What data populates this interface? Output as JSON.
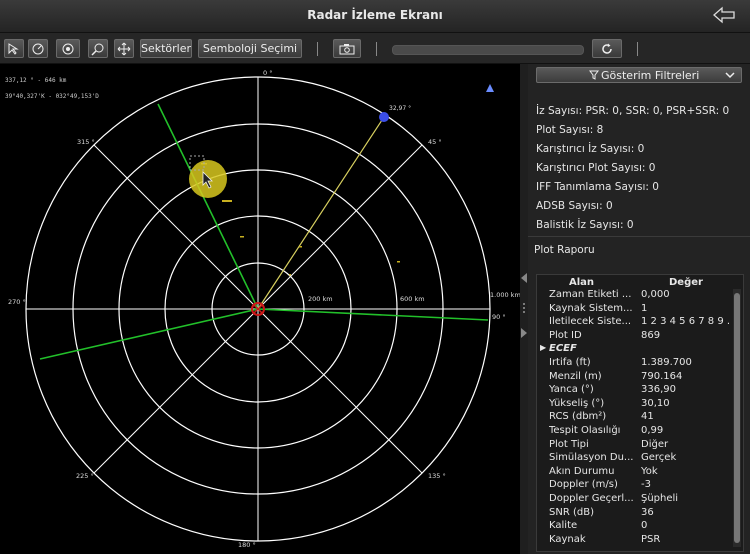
{
  "window": {
    "title": "Radar İzleme Ekranı"
  },
  "toolbar": {
    "icons": [
      "select-icon",
      "gauge-icon",
      "target-icon",
      "zoom-icon",
      "pan-icon"
    ],
    "sectors_label": "Sektörler",
    "symbology_label": "Semboloji Seçimi",
    "camera_icon": "camera-icon",
    "refresh_icon": "refresh-icon",
    "progress": 0
  },
  "radar": {
    "cursor_readout": "337,12 ° - 646 km",
    "cursor_latlon": "39°40,327'K - 032°49,153'D",
    "range_labels": [
      "200 km",
      "600 km",
      "1.000 km"
    ],
    "bearing_labels": {
      "b0": "0 °",
      "b45": "45 °",
      "b90": "90 °",
      "b135": "135 °",
      "b180": "180 °",
      "b225": "225 °",
      "b270": "270 °",
      "b315": "315 °"
    },
    "target_label": "32,97 °",
    "colors": {
      "rings": "#ffffff",
      "green_line": "#22c02a",
      "yellow_line": "#d8d060",
      "target": "#3b4ee8",
      "highlight": "#d8c81e",
      "center": "#d01818"
    }
  },
  "filters": {
    "label": "Gösterim Filtreleri"
  },
  "stats": [
    "İz Sayısı: PSR: 0, SSR: 0, PSR+SSR: 0",
    "Plot Sayısı: 8",
    "Karıştırıcı İz Sayısı: 0",
    "Karıştırıcı Plot Sayısı: 0",
    "IFF Tanımlama Sayısı: 0",
    "ADSB Sayısı: 0",
    "Balistik İz Sayısı: 0"
  ],
  "plot_report": {
    "title": "Plot Raporu",
    "headers": {
      "field": "Alan",
      "value": "Değer"
    },
    "rows": [
      {
        "field": "Zaman Etiketi ...",
        "value": "0,000"
      },
      {
        "field": "Kaynak Sistem...",
        "value": "1"
      },
      {
        "field": "İletilecek Siste...",
        "value": "1 2 3 4 5 6 7 8 9 ..."
      },
      {
        "field": "Plot ID",
        "value": "869"
      },
      {
        "field": "ECEF",
        "value": "",
        "group": true
      },
      {
        "field": "İrtifa (ft)",
        "value": "1.389.700"
      },
      {
        "field": "Menzil (m)",
        "value": "790.164"
      },
      {
        "field": "Yanca (°)",
        "value": "336,90"
      },
      {
        "field": "Yükseliş (°)",
        "value": "30,10"
      },
      {
        "field": "RCS (dbm²)",
        "value": "41"
      },
      {
        "field": "Tespit Olasılığı",
        "value": "0,99"
      },
      {
        "field": "Plot Tipi",
        "value": "Diğer"
      },
      {
        "field": "Simülasyon Du...",
        "value": "Gerçek"
      },
      {
        "field": "Akın Durumu",
        "value": "Yok"
      },
      {
        "field": "Doppler (m/s)",
        "value": "-3"
      },
      {
        "field": "Doppler Geçerl...",
        "value": "Şüpheli"
      },
      {
        "field": "SNR (dB)",
        "value": "36"
      },
      {
        "field": "Kalite",
        "value": "0"
      },
      {
        "field": "Kaynak",
        "value": "PSR"
      }
    ]
  }
}
